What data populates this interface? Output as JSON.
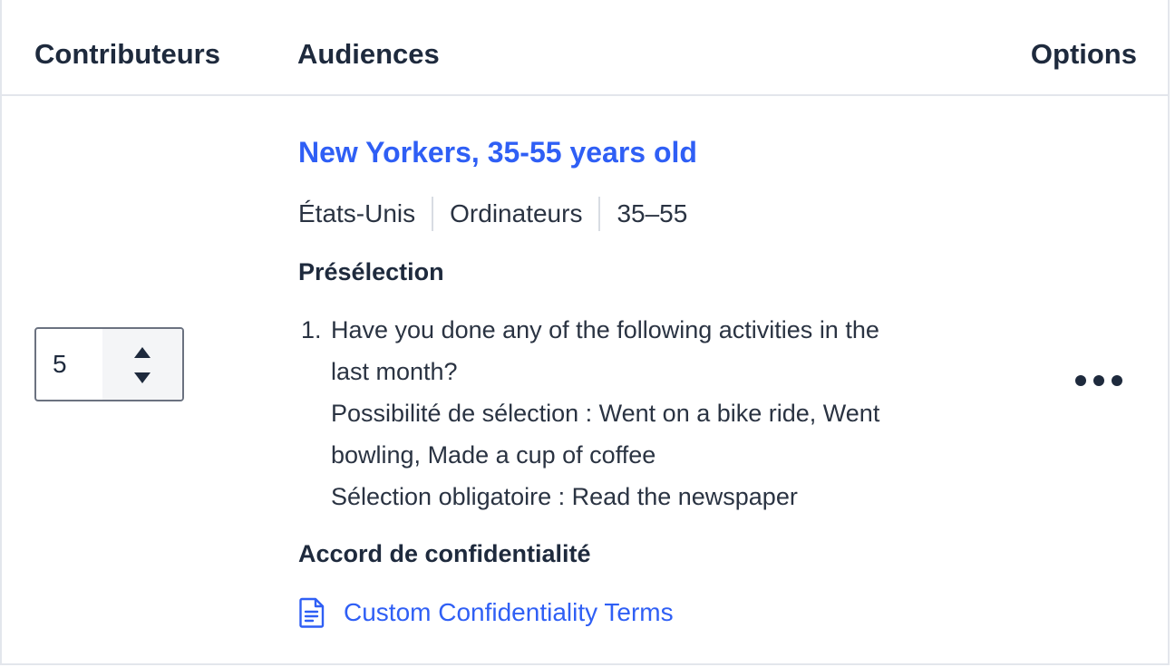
{
  "table": {
    "headers": {
      "contributors": "Contributeurs",
      "audiences": "Audiences",
      "options": "Options"
    }
  },
  "row": {
    "contributors_value": "5",
    "audience": {
      "title": "New Yorkers, 35-55 years old",
      "meta": [
        "États-Unis",
        "Ordinateurs",
        "35–55"
      ]
    },
    "preselection": {
      "label": "Présélection",
      "question_number": "1.",
      "question_lines": [
        "Have you done any of the following activities in the",
        "last month?",
        "Possibilité de sélection : Went on a bike ride, Went",
        "bowling, Made a cup of coffee",
        "Sélection obligatoire : Read the newspaper"
      ]
    },
    "confidentiality": {
      "label": "Accord de confidentialité",
      "link_text": "Custom Confidentiality Terms",
      "icon": "document-icon"
    },
    "options_icon": "more-horizontal-icon"
  },
  "colors": {
    "accent": "#2f5ff5",
    "text": "#1e2a3d",
    "border": "#e3e6ec"
  }
}
